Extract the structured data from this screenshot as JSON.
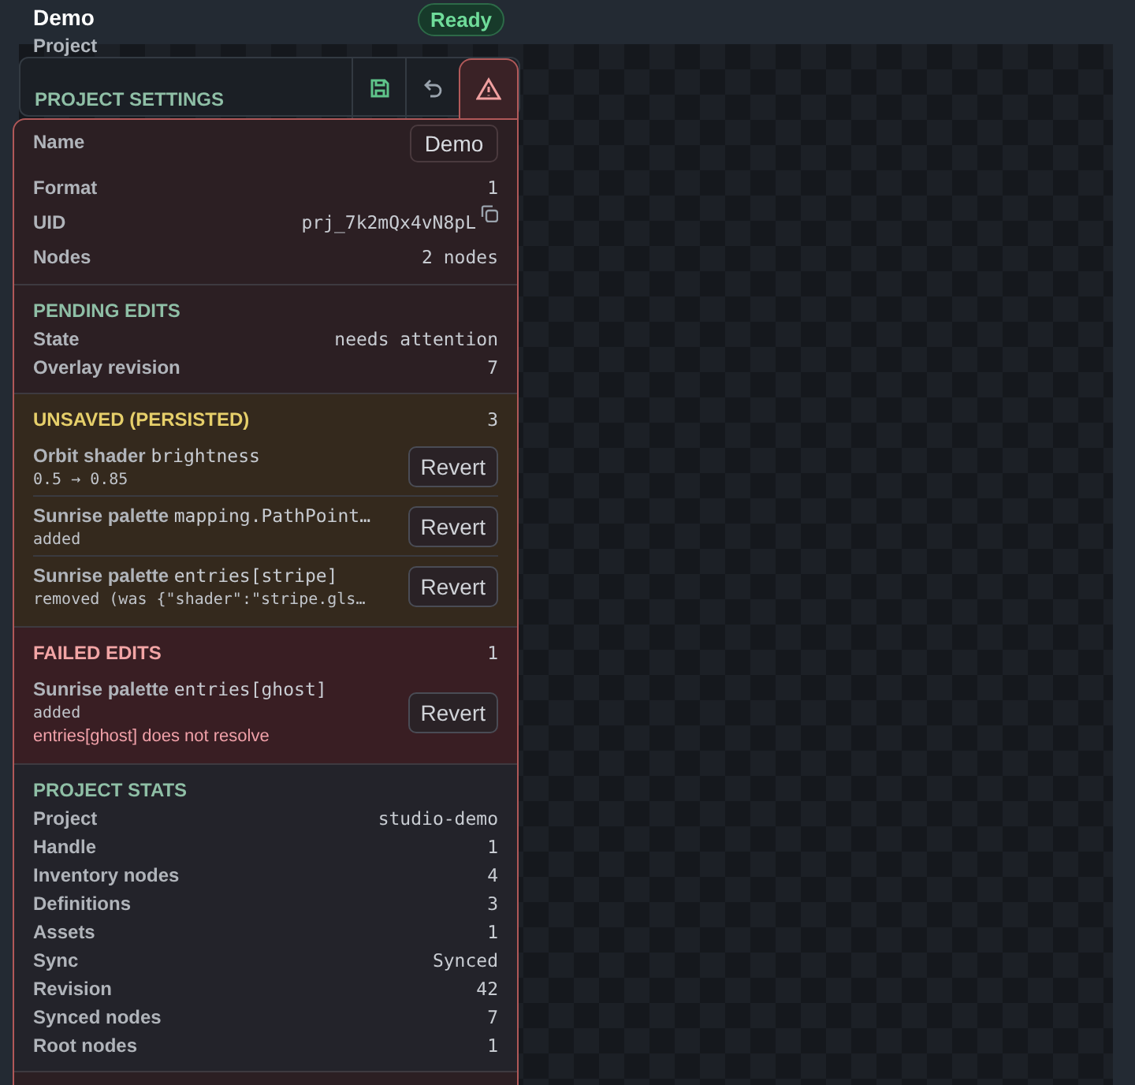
{
  "header": {
    "title": "Demo",
    "subtitle": "Project",
    "status": "Ready"
  },
  "toolbar": {
    "heading": "PROJECT SETTINGS",
    "buttons": [
      {
        "kind": "save",
        "selected": false
      },
      {
        "kind": "undo",
        "selected": false
      },
      {
        "kind": "warning",
        "selected": true
      }
    ]
  },
  "popover": {
    "name": {
      "label": "Name",
      "value": "Demo"
    },
    "info": [
      {
        "label": "Format",
        "value": "1",
        "copyable": false
      },
      {
        "label": "UID",
        "value": "prj_7k2mQx4vN8pL",
        "copyable": true
      },
      {
        "label": "Nodes",
        "value": "2 nodes",
        "copyable": false
      }
    ],
    "sections": [
      {
        "kind": "pending",
        "title": "PENDING EDITS",
        "rows": [
          {
            "label": "State",
            "value": "needs attention"
          },
          {
            "label": "Overlay revision",
            "value": "7"
          }
        ]
      },
      {
        "kind": "unsaved",
        "title": "UNSAVED (PERSISTED)",
        "count": "3",
        "edits": [
          {
            "target": "Orbit shader",
            "path": "brightness",
            "detail": "0.5 → 0.85",
            "action": "Revert"
          },
          {
            "target": "Sunrise palette",
            "path": "mapping.PathPoint…",
            "detail": "added",
            "action": "Revert"
          },
          {
            "target": "Sunrise palette",
            "path": "entries[stripe]",
            "detail": "removed (was {\"shader\":\"stripe.gls…",
            "action": "Revert"
          }
        ]
      },
      {
        "kind": "failed",
        "title": "FAILED EDITS",
        "count": "1",
        "edits": [
          {
            "target": "Sunrise palette",
            "path": "entries[ghost]",
            "detail": "added",
            "error": "entries[ghost] does not resolve",
            "action": "Revert"
          }
        ]
      },
      {
        "kind": "stats",
        "title": "PROJECT STATS",
        "rows": [
          {
            "label": "Project",
            "value": "studio-demo"
          },
          {
            "label": "Handle",
            "value": "1"
          },
          {
            "label": "Inventory nodes",
            "value": "4"
          },
          {
            "label": "Definitions",
            "value": "3"
          },
          {
            "label": "Assets",
            "value": "1"
          },
          {
            "label": "Sync",
            "value": "Synced"
          },
          {
            "label": "Revision",
            "value": "42"
          },
          {
            "label": "Synced nodes",
            "value": "7"
          },
          {
            "label": "Root nodes",
            "value": "1"
          }
        ]
      }
    ]
  }
}
